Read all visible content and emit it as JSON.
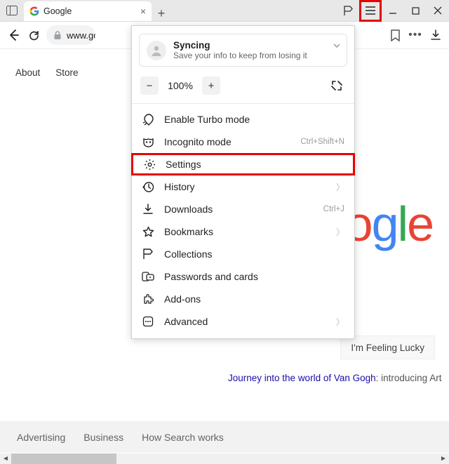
{
  "tab": {
    "title": "Google",
    "url": "www.google.com"
  },
  "toolbar": {
    "back": "Back",
    "reload": "Reload",
    "bookmark": "Bookmark",
    "more": "···",
    "download": "Download"
  },
  "page": {
    "nav": [
      "About",
      "Store"
    ],
    "lucky": "I'm Feeling Lucky",
    "promo_link": "Journey into the world of Van Gogh",
    "promo_rest": ": introducing Art",
    "footer": [
      "Advertising",
      "Business",
      "How Search works"
    ]
  },
  "menu": {
    "sync_title": "Syncing",
    "sync_sub": "Save your info to keep from losing it",
    "zoom": "100%",
    "items": [
      {
        "icon": "rocket-icon",
        "label": "Enable Turbo mode"
      },
      {
        "icon": "mask-icon",
        "label": "Incognito mode",
        "hint": "Ctrl+Shift+N"
      },
      {
        "icon": "gear-icon",
        "label": "Settings",
        "highlight": true
      },
      {
        "icon": "history-icon",
        "label": "History",
        "chev": true
      },
      {
        "icon": "download-icon",
        "label": "Downloads",
        "hint": "Ctrl+J"
      },
      {
        "icon": "star-icon",
        "label": "Bookmarks",
        "chev": true
      },
      {
        "icon": "flag-icon",
        "label": "Collections"
      },
      {
        "icon": "key-icon",
        "label": "Passwords and cards"
      },
      {
        "icon": "puzzle-icon",
        "label": "Add-ons"
      },
      {
        "icon": "dots-icon",
        "label": "Advanced",
        "chev": true
      }
    ]
  }
}
